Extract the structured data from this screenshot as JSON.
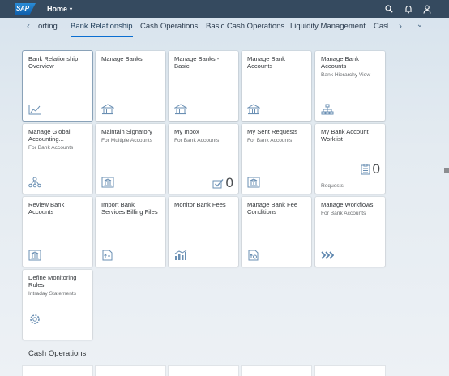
{
  "shell": {
    "logo": "SAP",
    "title": "Home",
    "title_caret": "▾"
  },
  "tabs": {
    "prev_arrow": "‹",
    "next_arrow": "›",
    "more_chevron": "⌄",
    "items": [
      {
        "label": "orting"
      },
      {
        "label": "Bank Relationship",
        "selected": true
      },
      {
        "label": "Cash Operations"
      },
      {
        "label": "Basic Cash Operations"
      },
      {
        "label": "Liquidity Management"
      },
      {
        "label": "Cash"
      }
    ]
  },
  "tiles": [
    {
      "title": "Bank Relationship Overview",
      "subtitle": "",
      "icon": "line-chart-icon"
    },
    {
      "title": "Manage Banks",
      "subtitle": "",
      "icon": "bank-icon"
    },
    {
      "title": "Manage Banks - Basic",
      "subtitle": "",
      "icon": "bank-icon"
    },
    {
      "title": "Manage Bank Accounts",
      "subtitle": "",
      "icon": "bank-icon"
    },
    {
      "title": "Manage Bank Accounts",
      "subtitle": "Bank Hierarchy View",
      "icon": "hierarchy-icon"
    },
    {
      "title": "Manage Global Accounting...",
      "subtitle": "For Bank Accounts",
      "icon": "network-icon"
    },
    {
      "title": "Maintain Signatory",
      "subtitle": "For Multiple Accounts",
      "icon": "bank-document-icon"
    },
    {
      "title": "My Inbox",
      "subtitle": "For Bank Accounts",
      "icon": "inbox-check-icon",
      "count": "0"
    },
    {
      "title": "My Sent Requests",
      "subtitle": "For Bank Accounts",
      "icon": "bank-document-icon"
    },
    {
      "title": "My Bank Account Worklist",
      "subtitle": "",
      "icon": "worklist-icon",
      "count": "0",
      "footer": "Requests"
    },
    {
      "title": "Review Bank Accounts",
      "subtitle": "",
      "icon": "bank-document-icon"
    },
    {
      "title": "Import Bank Services Billing Files",
      "subtitle": "",
      "icon": "import-document-icon"
    },
    {
      "title": "Monitor Bank Fees",
      "subtitle": "",
      "icon": "bank-chart-icon"
    },
    {
      "title": "Manage Bank Fee Conditions",
      "subtitle": "",
      "icon": "fee-document-icon"
    },
    {
      "title": "Manage Workflows",
      "subtitle": "For Bank Accounts",
      "icon": "workflow-arrows-icon"
    },
    {
      "title": "Define Monitoring Rules",
      "subtitle": "Intraday Statements",
      "icon": "settings-icon"
    }
  ],
  "sections": {
    "cash_operations": "Cash Operations"
  }
}
